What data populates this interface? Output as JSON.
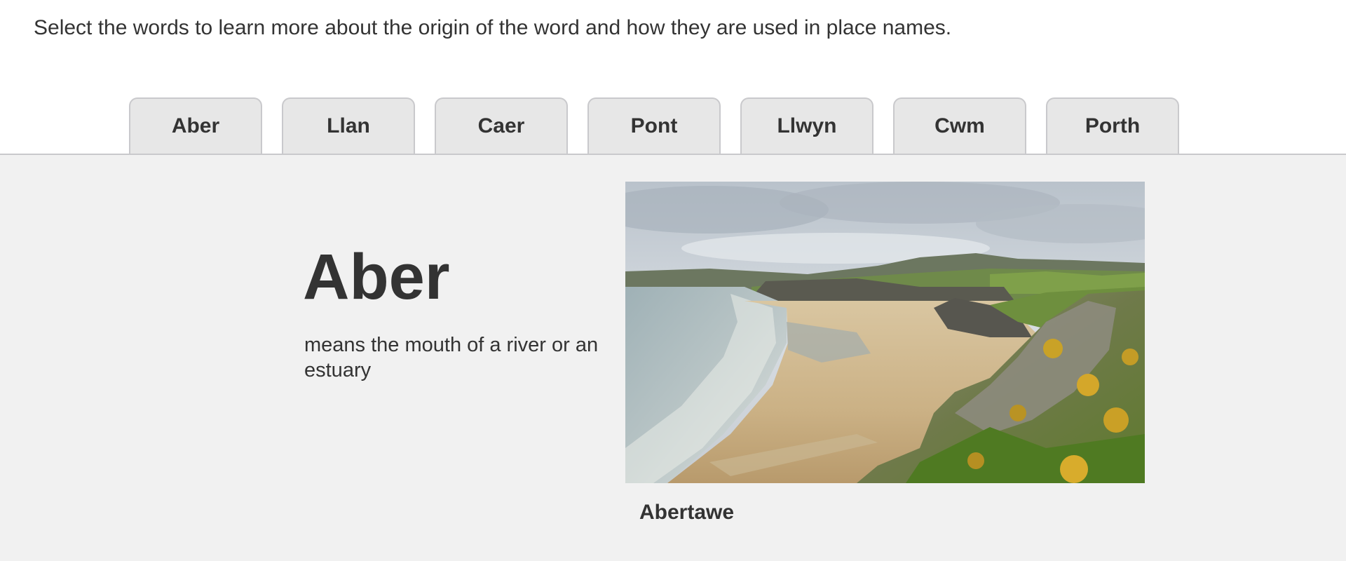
{
  "intro": {
    "text": "Select the words to learn more about the origin of the word and how they are used in place names."
  },
  "tabs": [
    {
      "label": "Aber"
    },
    {
      "label": "Llan"
    },
    {
      "label": "Caer"
    },
    {
      "label": "Pont"
    },
    {
      "label": "Llwyn"
    },
    {
      "label": "Cwm"
    },
    {
      "label": "Porth"
    }
  ],
  "selected_tab": "Aber",
  "content": {
    "word": "Aber",
    "description": "means the mouth of a river or an estuary",
    "image_caption": "Abertawe"
  },
  "colors": {
    "text": "#333333",
    "tab_background": "#e7e7e7",
    "tab_border": "#c9c9cc",
    "panel_background": "#f1f1f1"
  }
}
